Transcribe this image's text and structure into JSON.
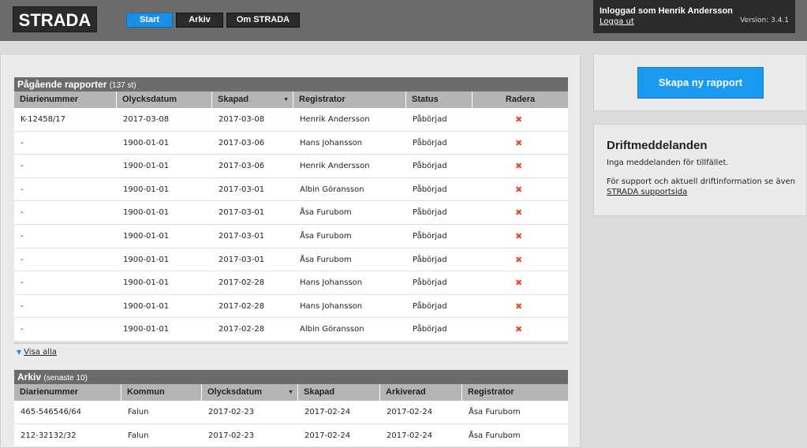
{
  "header": {
    "logo": "STRADA",
    "nav": [
      {
        "label": "Start",
        "active": true
      },
      {
        "label": "Arkiv",
        "active": false
      },
      {
        "label": "Om STRADA",
        "active": false
      }
    ],
    "user": {
      "logged_in_as": "Inloggad som Henrik Andersson",
      "logout": "Logga ut",
      "version": "Version: 3.4.1"
    }
  },
  "ongoing": {
    "title": "Pågående rapporter",
    "count": "(137 st)",
    "columns": [
      "Diarienummer",
      "Olycksdatum",
      "Skapad",
      "Registrator",
      "Status",
      "Radera"
    ],
    "sort_indicator": "▼",
    "delete_glyph": "✖",
    "rows": [
      {
        "diarienummer": "K-12458/17",
        "olycksdatum": "2017-03-08",
        "skapad": "2017-03-08",
        "registrator": "Henrik Andersson",
        "status": "Påbörjad"
      },
      {
        "diarienummer": "-",
        "olycksdatum": "1900-01-01",
        "skapad": "2017-03-06",
        "registrator": "Hans Johansson",
        "status": "Påbörjad"
      },
      {
        "diarienummer": "-",
        "olycksdatum": "1900-01-01",
        "skapad": "2017-03-06",
        "registrator": "Henrik Andersson",
        "status": "Påbörjad"
      },
      {
        "diarienummer": "-",
        "olycksdatum": "1900-01-01",
        "skapad": "2017-03-01",
        "registrator": "Albin Göransson",
        "status": "Påbörjad"
      },
      {
        "diarienummer": "-",
        "olycksdatum": "1900-01-01",
        "skapad": "2017-03-01",
        "registrator": "Åsa Furubom",
        "status": "Påbörjad"
      },
      {
        "diarienummer": "-",
        "olycksdatum": "1900-01-01",
        "skapad": "2017-03-01",
        "registrator": "Åsa Furubom",
        "status": "Påbörjad"
      },
      {
        "diarienummer": "-",
        "olycksdatum": "1900-01-01",
        "skapad": "2017-03-01",
        "registrator": "Åsa Furubom",
        "status": "Påbörjad"
      },
      {
        "diarienummer": "-",
        "olycksdatum": "1900-01-01",
        "skapad": "2017-02-28",
        "registrator": "Hans Johansson",
        "status": "Påbörjad"
      },
      {
        "diarienummer": "-",
        "olycksdatum": "1900-01-01",
        "skapad": "2017-02-28",
        "registrator": "Hans Johansson",
        "status": "Påbörjad"
      },
      {
        "diarienummer": "-",
        "olycksdatum": "1900-01-01",
        "skapad": "2017-02-28",
        "registrator": "Albin Göransson",
        "status": "Påbörjad"
      }
    ],
    "show_all": "Visa alla"
  },
  "archive": {
    "title": "Arkiv",
    "count": "(senaste 10)",
    "columns": [
      "Diarienummer",
      "Kommun",
      "Olycksdatum",
      "Skapad",
      "Arkiverad",
      "Registrator"
    ],
    "rows": [
      {
        "diarienummer": "465-546546/64",
        "kommun": "Falun",
        "olycksdatum": "2017-02-23",
        "skapad": "2017-02-24",
        "arkiverad": "2017-02-24",
        "registrator": "Åsa Furubom"
      },
      {
        "diarienummer": "212-32132/32",
        "kommun": "Falun",
        "olycksdatum": "2017-02-23",
        "skapad": "2017-02-24",
        "arkiverad": "2017-02-24",
        "registrator": "Åsa Furubom"
      }
    ]
  },
  "sidebar": {
    "create_button": "Skapa ny rapport",
    "drift": {
      "title": "Driftmeddelanden",
      "message": "Inga meddelanden för tillfället.",
      "support_text": "För support och aktuell driftinformation se även",
      "support_link": "STRADA supportsida"
    }
  }
}
